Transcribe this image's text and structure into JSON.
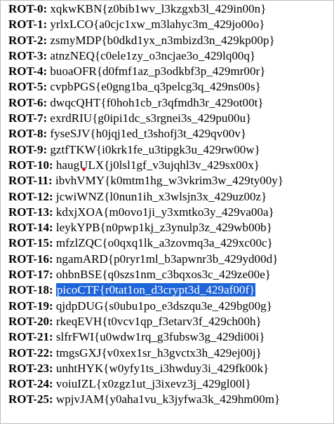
{
  "rows": [
    {
      "label": "ROT-0",
      "sep": ": ",
      "value": "xqkwKBN{z0bib1wv_l3kzgxb3l_429in00n}",
      "selected": false
    },
    {
      "label": "ROT-1",
      "sep": ": ",
      "value": "yrlxLCO{a0cjc1xw_m3lahyc3m_429jo00o}",
      "selected": false
    },
    {
      "label": "ROT-2",
      "sep": ": ",
      "value": "zsmyMDP{b0dkd1yx_n3mbizd3n_429kp00p}",
      "selected": false
    },
    {
      "label": "ROT-3",
      "sep": ": ",
      "value": "atnzNEQ{c0ele1zy_o3ncjae3o_429lq00q}",
      "selected": false
    },
    {
      "label": "ROT-4",
      "sep": ": ",
      "value": "buoaOFR{d0fmf1az_p3odkbf3p_429mr00r}",
      "selected": false
    },
    {
      "label": "ROT-5",
      "sep": ": ",
      "value": "cvpbPGS{e0gng1ba_q3pelcg3q_429ns00s}",
      "selected": false
    },
    {
      "label": "ROT-6",
      "sep": ": ",
      "value": "dwqcQHT{f0hoh1cb_r3qfmdh3r_429ot00t}",
      "selected": false
    },
    {
      "label": "ROT-7",
      "sep": ": ",
      "value": "exrdRIU{g0ipi1dc_s3rgnei3s_429pu00u}",
      "selected": false
    },
    {
      "label": "ROT-8",
      "sep": ": ",
      "value": "fyseSJV{h0jqj1ed_t3shofj3t_429qv00v}",
      "selected": false
    },
    {
      "label": "ROT-9",
      "sep": ": ",
      "value": "gztfTKW{i0krk1fe_u3tipgk3u_429rw00w}",
      "selected": false
    },
    {
      "label": "ROT-10",
      "sep": ": ",
      "value": "haugULX{j0lsl1gf_v3ujqhl3v_429sx00x}",
      "selected": false
    },
    {
      "label": "ROT-11",
      "sep": ": ",
      "value": "ibvhVMY{k0mtm1hg_w3vkrim3w_429ty00y}",
      "selected": false
    },
    {
      "label": "ROT-12",
      "sep": ": ",
      "value": "jcwiWNZ{l0nun1ih_x3wlsjn3x_429uz00z}",
      "selected": false
    },
    {
      "label": "ROT-13",
      "sep": ": ",
      "value": "kdxjXOA{m0ovo1ji_y3xmtko3y_429va00a}",
      "selected": false
    },
    {
      "label": "ROT-14",
      "sep": ": ",
      "value": "leykYPB{n0pwp1kj_z3ynulp3z_429wb00b}",
      "selected": false
    },
    {
      "label": "ROT-15",
      "sep": ": ",
      "value": "mfzlZQC{o0qxq1lk_a3zovmq3a_429xc00c}",
      "selected": false
    },
    {
      "label": "ROT-16",
      "sep": ": ",
      "value": "ngamARD{p0ryr1ml_b3apwnr3b_429yd00d}",
      "selected": false
    },
    {
      "label": "ROT-17",
      "sep": ": ",
      "value": "ohbnBSE{q0szs1nm_c3bqxos3c_429ze00e}",
      "selected": false
    },
    {
      "label": "ROT-18",
      "sep": ": ",
      "value": "picoCTF{r0tat1on_d3crypt3d_429af00f}",
      "selected": true
    },
    {
      "label": "ROT-19",
      "sep": ": ",
      "value": "qjdpDUG{s0ubu1po_e3dszqu3e_429bg00g}",
      "selected": false
    },
    {
      "label": "ROT-20",
      "sep": ": ",
      "value": "rkeqEVH{t0vcv1qp_f3etarv3f_429ch00h}",
      "selected": false
    },
    {
      "label": "ROT-21",
      "sep": ": ",
      "value": "slfrFWI{u0wdw1rq_g3fubsw3g_429di00i}",
      "selected": false
    },
    {
      "label": "ROT-22",
      "sep": ": ",
      "value": "tmgsGXJ{v0xex1sr_h3gvctx3h_429ej00j}",
      "selected": false
    },
    {
      "label": "ROT-23",
      "sep": ": ",
      "value": "unhtHYK{w0yfy1ts_i3hwduy3i_429fk00k}",
      "selected": false
    },
    {
      "label": "ROT-24",
      "sep": ": ",
      "value": "voiuIZL{x0zgz1ut_j3ixevz3j_429gl00l}",
      "selected": false
    },
    {
      "label": "ROT-25",
      "sep": ": ",
      "value": "wpjvJAM{y0aha1vu_k3jyfwa3k_429hm00m}",
      "selected": false
    }
  ],
  "colors": {
    "selection_background": "#1e64d8",
    "selection_text": "#ffffff",
    "text": "#000000",
    "cursor": "#d02020"
  }
}
